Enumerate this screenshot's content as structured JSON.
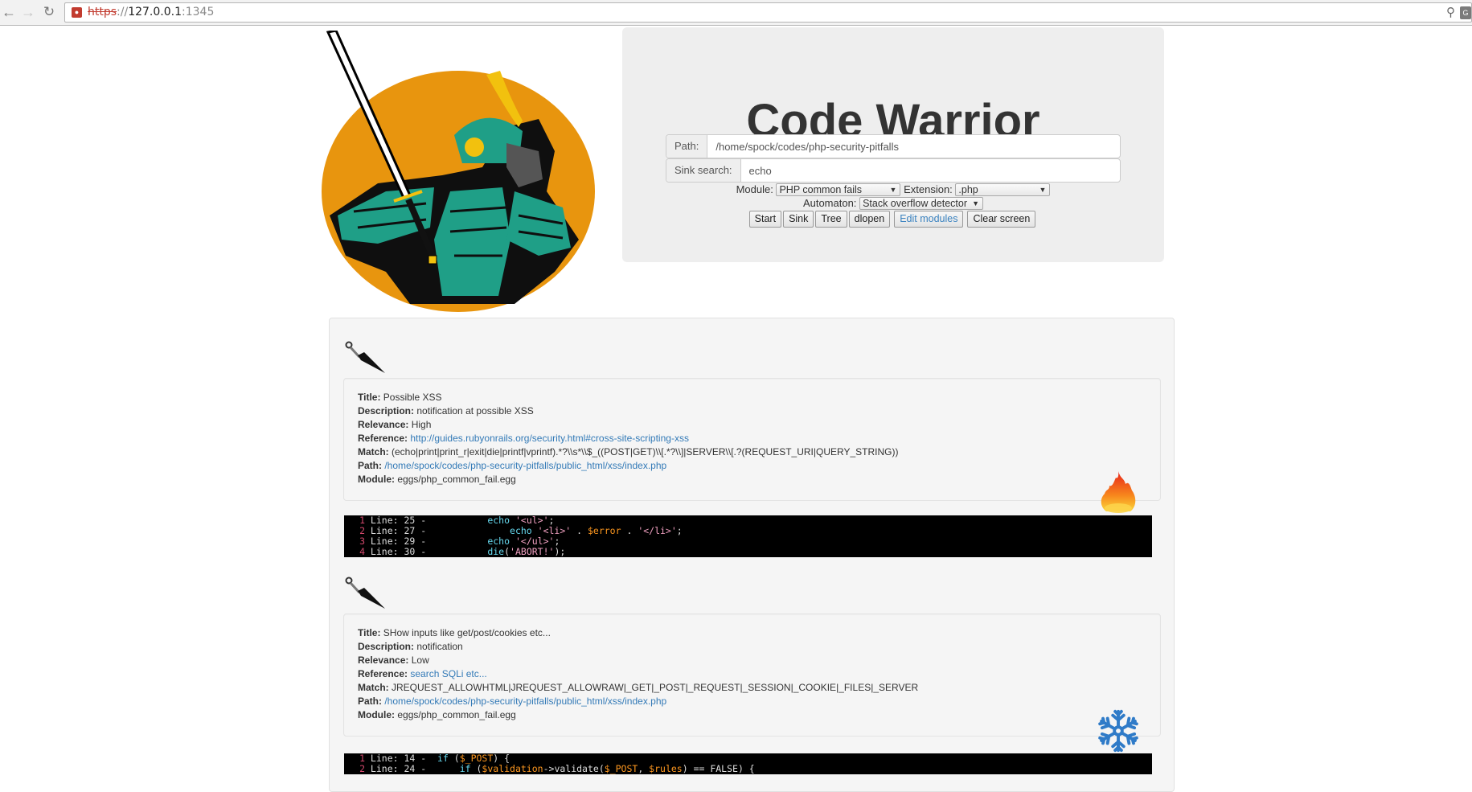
{
  "browser": {
    "url_scheme": "https",
    "url_sep": "://",
    "url_host": "127.0.0.1",
    "url_port": ":1345",
    "icons": [
      "back-arrow-icon",
      "forward-arrow-icon",
      "reload-icon",
      "lock-broken-icon",
      "zoom-icon",
      "extension-icon"
    ]
  },
  "app": {
    "title": "Code Warrior",
    "logo": "samurai-warrior-logo"
  },
  "form": {
    "path_label": "Path:",
    "path_value": "/home/spock/codes/php-security-pitfalls",
    "sink_label": "Sink search:",
    "sink_value": "echo",
    "module_label": "Module:",
    "module_value": "PHP common fails",
    "extension_label": "Extension:",
    "extension_value": ".php",
    "automaton_label": "Automaton:",
    "automaton_value": "Stack overflow detector",
    "buttons": {
      "start": "Start",
      "sink": "Sink",
      "tree": "Tree",
      "dlopen": "dlopen",
      "edit_modules": "Edit modules",
      "clear_screen": "Clear screen"
    }
  },
  "labels": {
    "title": "Title:",
    "description": "Description:",
    "relevance": "Relevance:",
    "reference": "Reference:",
    "match": "Match:",
    "path": "Path:",
    "module": "Module:"
  },
  "results": [
    {
      "title": "Possible XSS",
      "description": "notification at possible XSS",
      "relevance": "High",
      "relevance_icon": "fire-icon",
      "reference": "http://guides.rubyonrails.org/security.html#cross-site-scripting-xss",
      "match": "(echo|print|print_r|exit|die|printf|vprintf).*?\\\\s*\\\\$_((POST|GET)\\\\[.*?\\\\]|SERVER\\\\[.?(REQUEST_URI|QUERY_STRING))",
      "path": "/home/spock/codes/php-security-pitfalls/public_html/xss/index.php",
      "module": "eggs/php_common_fail.egg",
      "code": [
        {
          "n": "1",
          "prefix": " Line: 25 -           ",
          "parts": [
            [
              "k",
              "echo"
            ],
            [
              "p",
              " "
            ],
            [
              "str",
              "'<ul>'"
            ],
            [
              "p",
              ";"
            ]
          ]
        },
        {
          "n": "2",
          "prefix": " Line: 27 -               ",
          "parts": [
            [
              "k",
              "echo"
            ],
            [
              "p",
              " "
            ],
            [
              "str",
              "'<li>'"
            ],
            [
              "p",
              " . "
            ],
            [
              "v",
              "$error"
            ],
            [
              "p",
              " . "
            ],
            [
              "str",
              "'</li>'"
            ],
            [
              "p",
              ";"
            ]
          ]
        },
        {
          "n": "3",
          "prefix": " Line: 29 -           ",
          "parts": [
            [
              "k",
              "echo"
            ],
            [
              "p",
              " "
            ],
            [
              "str",
              "'</ul>'"
            ],
            [
              "p",
              ";"
            ]
          ]
        },
        {
          "n": "4",
          "prefix": " Line: 30 -           ",
          "parts": [
            [
              "k",
              "die"
            ],
            [
              "p",
              "("
            ],
            [
              "str",
              "'ABORT!'"
            ],
            [
              "p",
              ");"
            ]
          ]
        }
      ]
    },
    {
      "title": "SHow inputs like get/post/cookies etc...",
      "description": "notification",
      "relevance": "Low",
      "relevance_icon": "snowflake-icon",
      "reference": "search SQLi etc...",
      "match": "JREQUEST_ALLOWHTML|JREQUEST_ALLOWRAW|_GET|_POST|_REQUEST|_SESSION|_COOKIE|_FILES|_SERVER",
      "path": "/home/spock/codes/php-security-pitfalls/public_html/xss/index.php",
      "module": "eggs/php_common_fail.egg",
      "code": [
        {
          "n": "1",
          "prefix": " Line: 14 -  ",
          "parts": [
            [
              "k",
              "if"
            ],
            [
              "p",
              " ("
            ],
            [
              "v",
              "$_POST"
            ],
            [
              "p",
              ") {"
            ]
          ]
        },
        {
          "n": "2",
          "prefix": " Line: 24 -      ",
          "parts": [
            [
              "k",
              "if"
            ],
            [
              "p",
              " ("
            ],
            [
              "v",
              "$validation"
            ],
            [
              "p",
              "->validate("
            ],
            [
              "v",
              "$_POST"
            ],
            [
              "p",
              ", "
            ],
            [
              "v",
              "$rules"
            ],
            [
              "p",
              ") == FALSE) {"
            ]
          ]
        }
      ]
    }
  ]
}
